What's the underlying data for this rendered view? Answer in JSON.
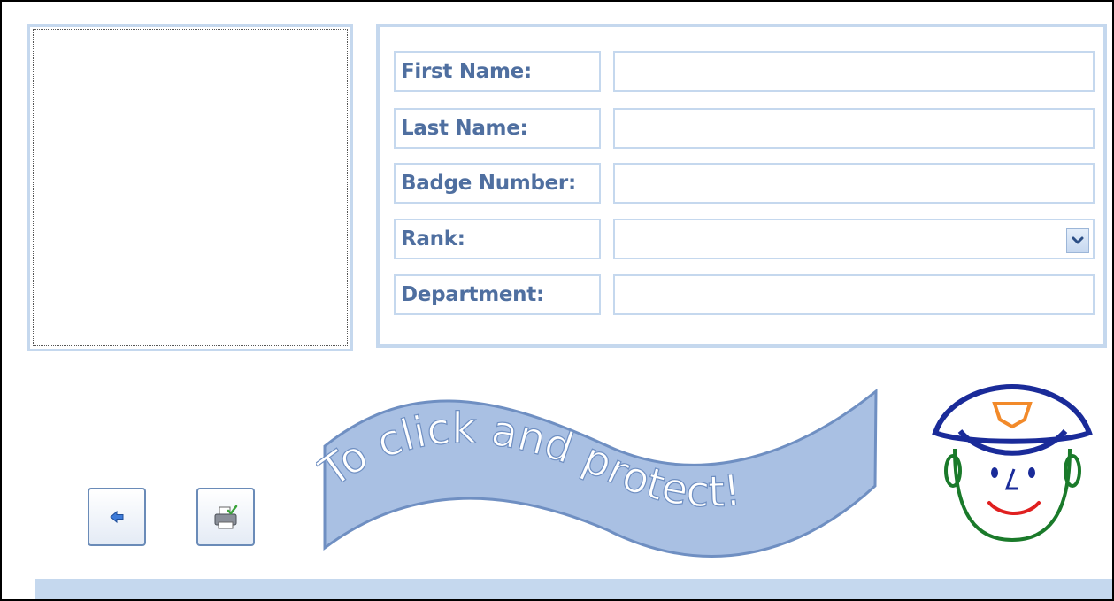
{
  "form": {
    "fields": [
      {
        "label": "First Name:",
        "value": ""
      },
      {
        "label": "Last Name:",
        "value": ""
      },
      {
        "label": "Badge Number:",
        "value": ""
      },
      {
        "label": "Rank:",
        "value": ""
      },
      {
        "label": "Department:",
        "value": ""
      }
    ]
  },
  "banner": {
    "text": "To click and protect!"
  },
  "buttons": {
    "back_icon": "back-arrow-icon",
    "print_icon": "printer-icon"
  },
  "colors": {
    "accent": "#c5d8ee",
    "label_text": "#4f6fa0",
    "banner_fill": "#a9c0e3",
    "button_border": "#6a8bb8"
  }
}
